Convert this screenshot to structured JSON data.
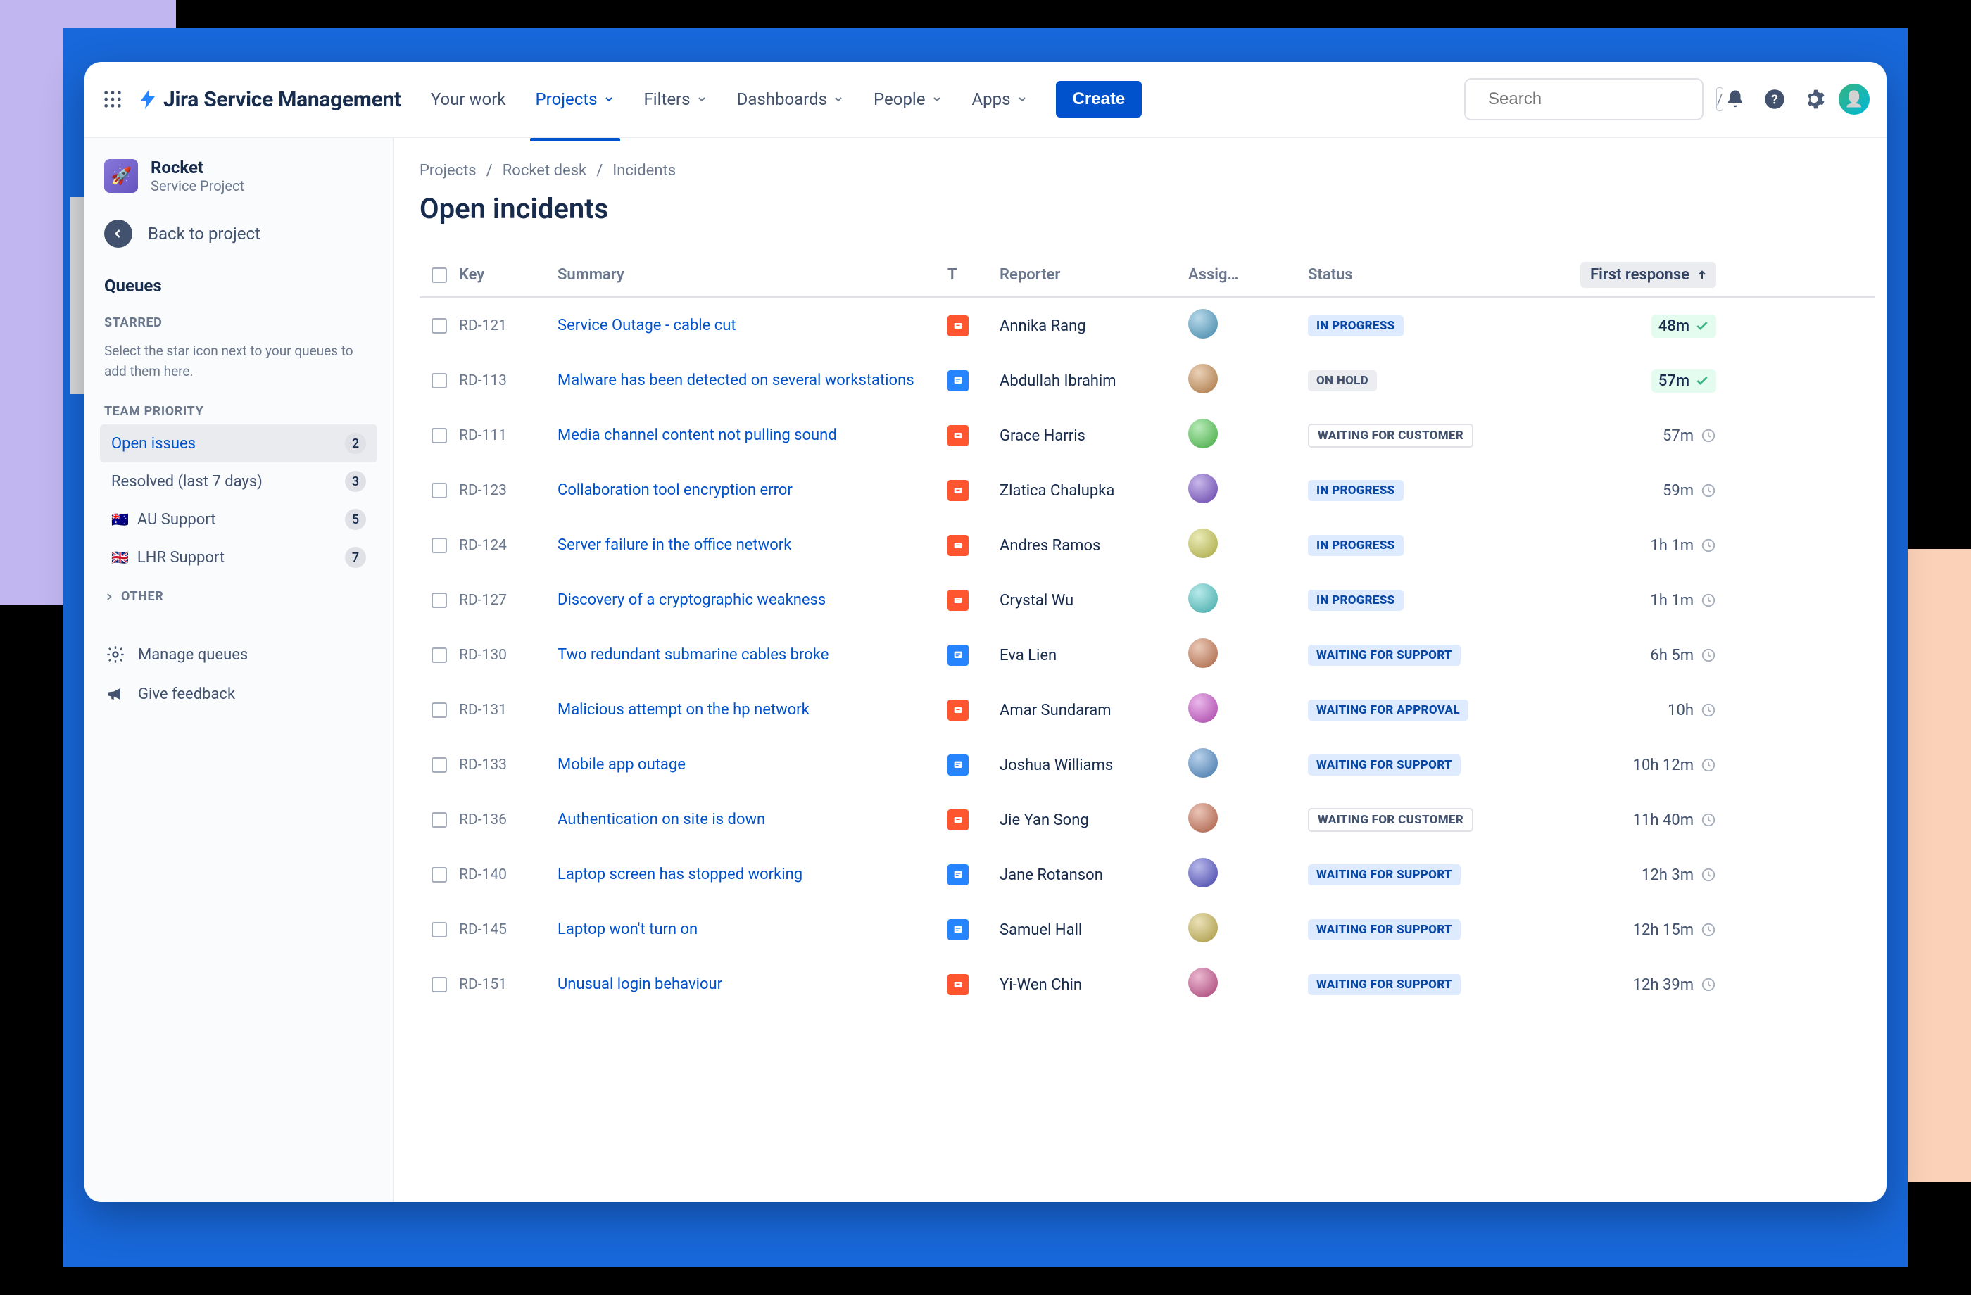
{
  "brand": "Jira Service Management",
  "nav": {
    "items": [
      "Your work",
      "Projects",
      "Filters",
      "Dashboards",
      "People",
      "Apps"
    ],
    "activeIndex": 1,
    "createLabel": "Create",
    "searchPlaceholder": "Search"
  },
  "sidebar": {
    "project": {
      "name": "Rocket",
      "subtitle": "Service Project"
    },
    "backLabel": "Back to project",
    "queuesTitle": "Queues",
    "starredLabel": "STARRED",
    "starredHint": "Select the star icon next to your queues to add them here.",
    "teamPriorityLabel": "TEAM PRIORITY",
    "queues": [
      {
        "label": "Open issues",
        "count": "2",
        "active": true,
        "flag": ""
      },
      {
        "label": "Resolved (last 7 days)",
        "count": "3",
        "active": false,
        "flag": ""
      },
      {
        "label": "AU Support",
        "count": "5",
        "active": false,
        "flag": "🇦🇺"
      },
      {
        "label": "LHR Support",
        "count": "7",
        "active": false,
        "flag": "🇬🇧"
      }
    ],
    "otherLabel": "OTHER",
    "manageQueues": "Manage queues",
    "giveFeedback": "Give feedback"
  },
  "breadcrumbs": [
    "Projects",
    "Rocket desk",
    "Incidents"
  ],
  "pageTitle": "Open incidents",
  "columns": {
    "key": "Key",
    "summary": "Summary",
    "type": "T",
    "reporter": "Reporter",
    "assignee": "Assig…",
    "status": "Status",
    "firstResponse": "First response"
  },
  "sortAsc": true,
  "statusLabels": {
    "inprogress": "IN PROGRESS",
    "onhold": "ON HOLD",
    "waitingcust": "WAITING FOR CUSTOMER",
    "waitingsupp": "WAITING FOR SUPPORT",
    "waitingappr": "WAITING FOR APPROVAL"
  },
  "rows": [
    {
      "key": "RD-121",
      "summary": "Service Outage - cable cut",
      "type": "orange",
      "reporter": "Annika Rang",
      "status": "inprogress",
      "response": "48m",
      "respStatus": "good"
    },
    {
      "key": "RD-113",
      "summary": "Malware has been detected on several workstations",
      "type": "blue",
      "reporter": "Abdullah Ibrahim",
      "status": "onhold",
      "response": "57m",
      "respStatus": "good"
    },
    {
      "key": "RD-111",
      "summary": "Media channel content not pulling sound",
      "type": "orange",
      "reporter": "Grace Harris",
      "status": "waitingcust",
      "response": "57m",
      "respStatus": "clock"
    },
    {
      "key": "RD-123",
      "summary": "Collaboration tool encryption error",
      "type": "orange",
      "reporter": "Zlatica Chalupka",
      "status": "inprogress",
      "response": "59m",
      "respStatus": "clock"
    },
    {
      "key": "RD-124",
      "summary": "Server failure in the office network",
      "type": "orange",
      "reporter": "Andres Ramos",
      "status": "inprogress",
      "response": "1h 1m",
      "respStatus": "clock"
    },
    {
      "key": "RD-127",
      "summary": "Discovery of a cryptographic weakness",
      "type": "orange",
      "reporter": "Crystal Wu",
      "status": "inprogress",
      "response": "1h 1m",
      "respStatus": "clock"
    },
    {
      "key": "RD-130",
      "summary": "Two redundant submarine cables broke",
      "type": "blue",
      "reporter": "Eva Lien",
      "status": "waitingsupp",
      "response": "6h 5m",
      "respStatus": "clock"
    },
    {
      "key": "RD-131",
      "summary": "Malicious attempt on the hp network",
      "type": "orange",
      "reporter": "Amar Sundaram",
      "status": "waitingappr",
      "response": "10h",
      "respStatus": "clock"
    },
    {
      "key": "RD-133",
      "summary": "Mobile app outage",
      "type": "blue",
      "reporter": "Joshua Williams",
      "status": "waitingsupp",
      "response": "10h 12m",
      "respStatus": "clock"
    },
    {
      "key": "RD-136",
      "summary": "Authentication on site is down",
      "type": "orange",
      "reporter": "Jie Yan Song",
      "status": "waitingcust",
      "response": "11h 40m",
      "respStatus": "clock"
    },
    {
      "key": "RD-140",
      "summary": "Laptop screen has stopped working",
      "type": "blue",
      "reporter": "Jane Rotanson",
      "status": "waitingsupp",
      "response": "12h 3m",
      "respStatus": "clock"
    },
    {
      "key": "RD-145",
      "summary": "Laptop won't turn on",
      "type": "blue",
      "reporter": "Samuel Hall",
      "status": "waitingsupp",
      "response": "12h 15m",
      "respStatus": "clock"
    },
    {
      "key": "RD-151",
      "summary": "Unusual login behaviour",
      "type": "orange",
      "reporter": "Yi-Wen Chin",
      "status": "waitingsupp",
      "response": "12h 39m",
      "respStatus": "clock"
    }
  ],
  "avatarHues": [
    200,
    30,
    120,
    260,
    60,
    180,
    20,
    300,
    210,
    15,
    240,
    50,
    330
  ]
}
